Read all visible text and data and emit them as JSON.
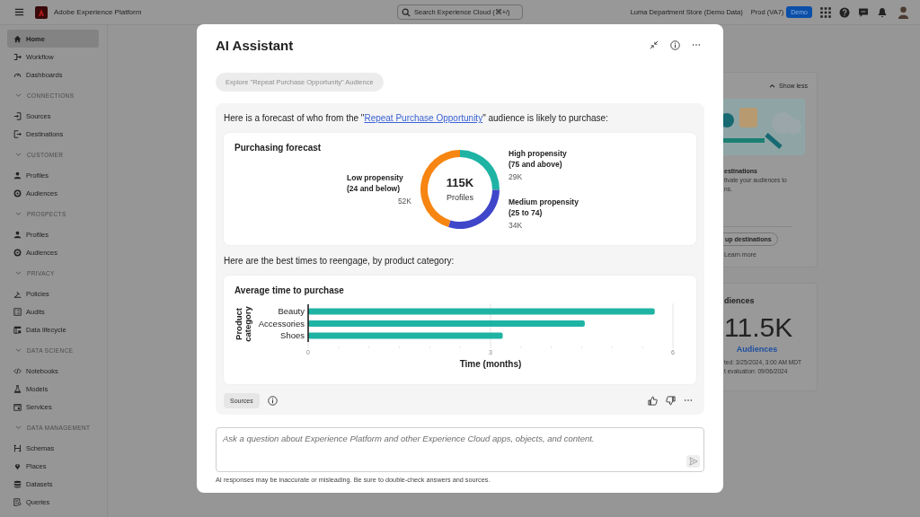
{
  "header": {
    "app_title": "Adobe Experience Platform",
    "search": {
      "placeholder": "Search Experience Cloud (⌘+/)"
    },
    "org": "Luma Department Store (Demo Data)",
    "sandbox": "Prod (VA7)",
    "badge": "Demo"
  },
  "sidebar": {
    "items": [
      {
        "label": "Home",
        "kind": "home",
        "selected": true
      },
      {
        "label": "Workflow",
        "kind": "workflow",
        "selected": false
      },
      {
        "label": "Dashboards",
        "kind": "gauge",
        "selected": false
      }
    ],
    "sections": [
      {
        "title": "CONNECTIONS",
        "expanded": true,
        "items": [
          {
            "label": "Sources",
            "kind": "enter",
            "selected": false
          },
          {
            "label": "Destinations",
            "kind": "exit",
            "selected": false
          }
        ]
      },
      {
        "title": "CUSTOMER",
        "expanded": true,
        "items": [
          {
            "label": "Profiles",
            "kind": "person",
            "selected": false
          },
          {
            "label": "Audiences",
            "kind": "target",
            "selected": false
          }
        ]
      },
      {
        "title": "PROSPECTS",
        "expanded": true,
        "items": [
          {
            "label": "Profiles",
            "kind": "person",
            "selected": false
          },
          {
            "label": "Audiences",
            "kind": "target",
            "selected": false
          }
        ]
      },
      {
        "title": "PRIVACY",
        "expanded": true,
        "items": [
          {
            "label": "Policies",
            "kind": "gavel",
            "selected": false
          },
          {
            "label": "Audits",
            "kind": "list",
            "selected": false
          },
          {
            "label": "Data lifecycle",
            "kind": "table",
            "selected": false
          }
        ]
      },
      {
        "title": "DATA SCIENCE",
        "expanded": true,
        "items": [
          {
            "label": "Notebooks",
            "kind": "code",
            "selected": false
          },
          {
            "label": "Models",
            "kind": "flask",
            "selected": false
          },
          {
            "label": "Services",
            "kind": "window",
            "selected": false
          }
        ]
      },
      {
        "title": "DATA MANAGEMENT",
        "expanded": true,
        "items": [
          {
            "label": "Schemas",
            "kind": "schema",
            "selected": false
          },
          {
            "label": "Places",
            "kind": "pin",
            "selected": false
          },
          {
            "label": "Datasets",
            "kind": "database",
            "selected": false
          },
          {
            "label": "Queries",
            "kind": "query",
            "selected": false
          }
        ]
      }
    ]
  },
  "background": {
    "show_less": "Show less",
    "card_title": "estinations",
    "card_lines": [
      "tivate your audiences to",
      "ns."
    ],
    "setup_button": "up destinations",
    "learn_more": "Learn more",
    "stat_title": "diences",
    "stat_value": "11.5K",
    "stat_link": "Audiences",
    "stat_lines": [
      "ted: 3/25/2024, 3:00 AM MDT",
      "t evaluation: 09/06/2024"
    ]
  },
  "modal": {
    "title": "AI Assistant",
    "suggestion": {
      "label": "Explore \"Repeat Purchase Opportunity\" Audience",
      "disabled": true
    },
    "intro": {
      "before": "Here is a forecast of who from the \"",
      "link": "Repeat Purchase Opportunity",
      "after": "\" audience is likely to purchase:"
    },
    "forecast": {
      "total": "115K",
      "total_label": "Profiles",
      "chart_data": {
        "type": "donut",
        "title": "Purchasing forecast",
        "categories": [
          "High propensity (75 and above)",
          "Medium propensity (25 to 74)",
          "Low propensity (24 and below)"
        ],
        "values": [
          29,
          34,
          52
        ],
        "value_labels": [
          "29K",
          "34K",
          "52K"
        ]
      }
    },
    "reengage_text": "Here are the best times to reengage, by product category:",
    "timing": {
      "chart_data": {
        "type": "bar",
        "orientation": "horizontal",
        "title": "Average time to purchase",
        "xlabel": "Time (months)",
        "ylabel": "Product category",
        "categories": [
          "Beauty",
          "Accessories",
          "Shoes"
        ],
        "values": [
          5.7,
          4.55,
          3.2
        ],
        "xlim": [
          0,
          6
        ],
        "xticks": [
          0,
          3,
          6
        ]
      }
    },
    "sources_button": "Sources",
    "input": {
      "placeholder": "Ask a question about Experience Platform and other Experience Cloud apps, objects, and content."
    },
    "disclaimer": "AI responses may be inaccurate or misleading. Be sure to double-check answers and sources."
  }
}
